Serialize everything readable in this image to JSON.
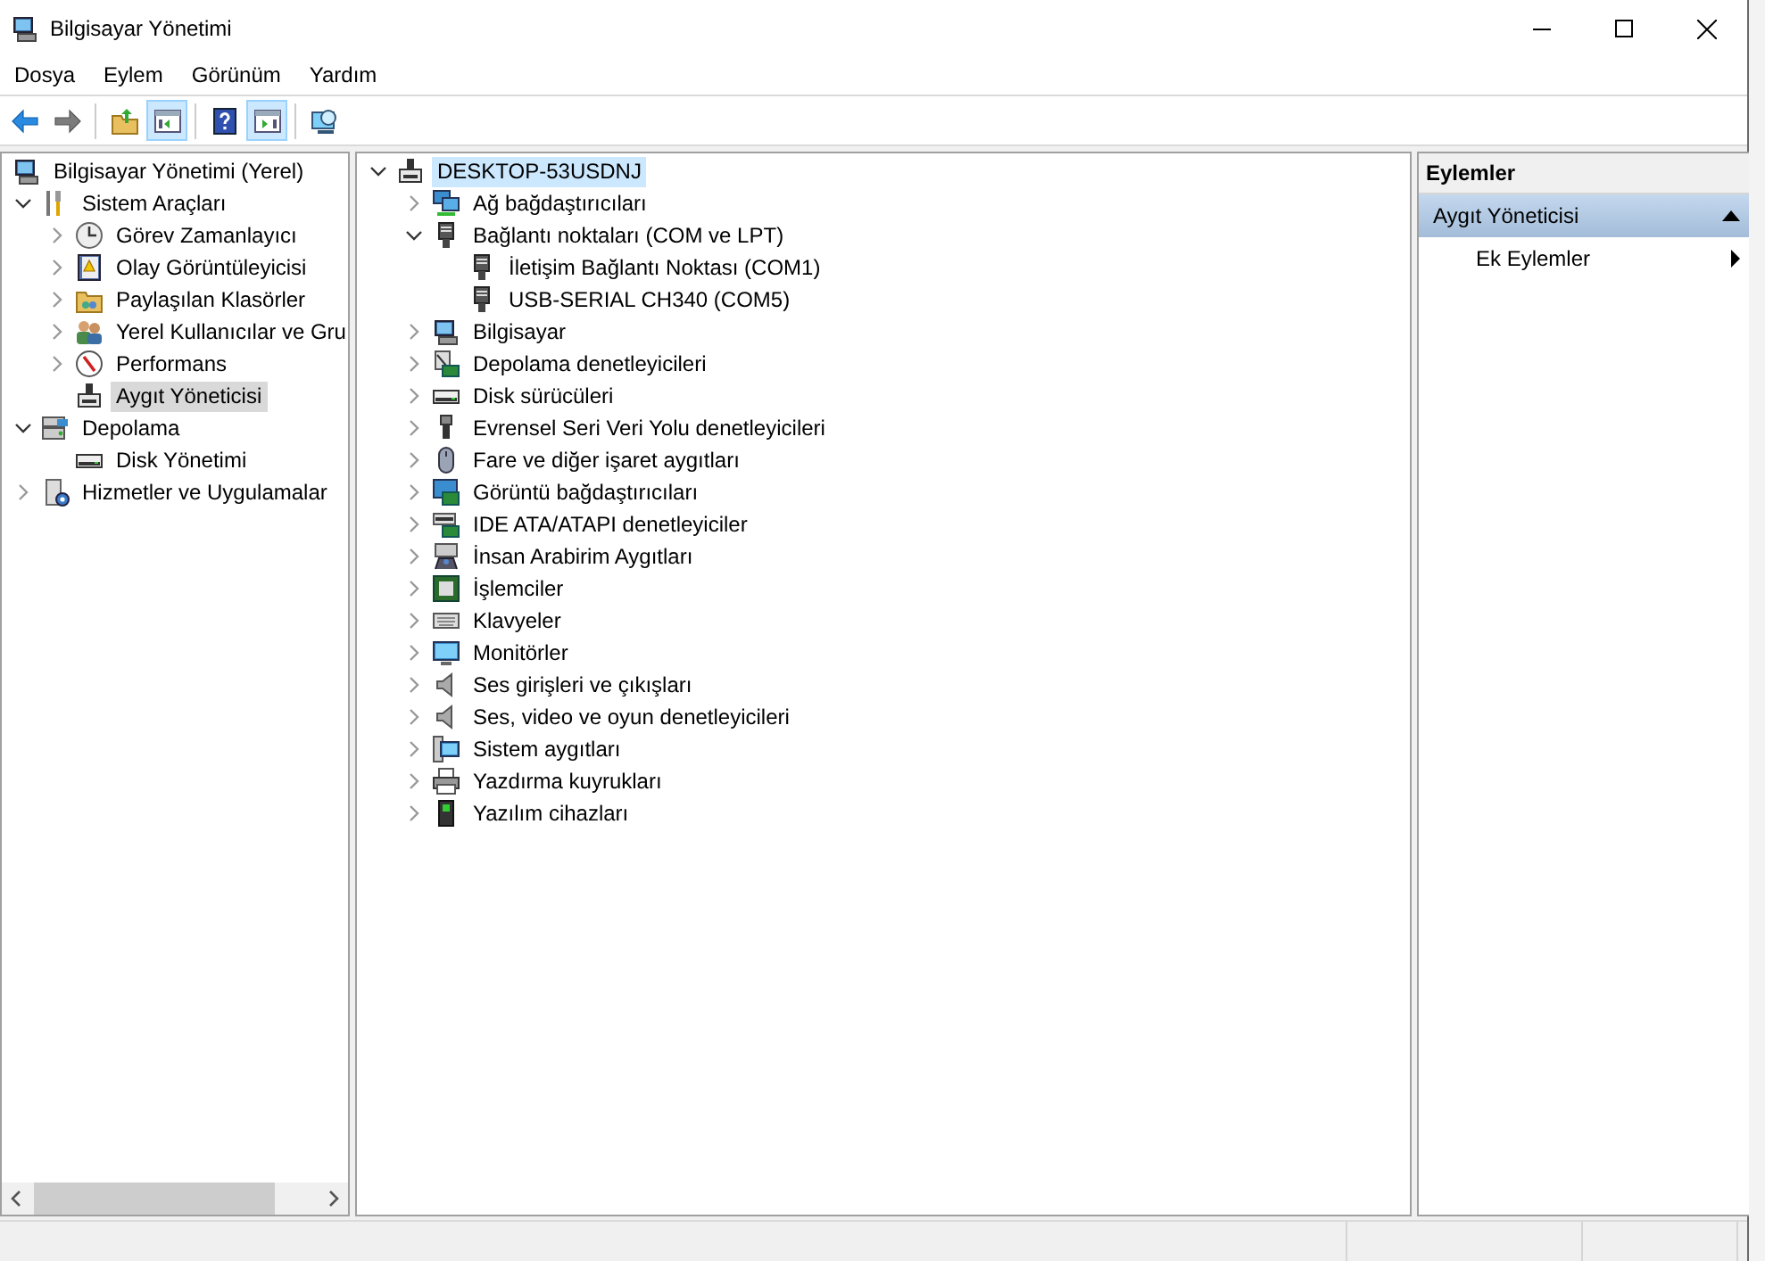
{
  "window": {
    "title": "Bilgisayar Yönetimi"
  },
  "menu": [
    "Dosya",
    "Eylem",
    "Görünüm",
    "Yardım"
  ],
  "toolbar": [
    {
      "pressed": false,
      "disabled": false
    },
    {
      "pressed": false,
      "disabled": true
    },
    {
      "pressed": false,
      "disabled": false
    },
    {
      "pressed": true,
      "disabled": false
    },
    {
      "pressed": false,
      "disabled": false
    },
    {
      "pressed": true,
      "disabled": false
    },
    {
      "pressed": false,
      "disabled": false
    }
  ],
  "nav_tree": {
    "items": [
      {
        "label": "Bilgisayar Yönetimi (Yerel)",
        "kind": "root",
        "selected": false,
        "children": [
          {
            "label": "Sistem Araçları",
            "kind": "node",
            "expanded": true,
            "selected": false,
            "children": [
              {
                "label": "Görev Zamanlayıcı",
                "kind": "node",
                "expanded": false,
                "selected": false
              },
              {
                "label": "Olay Görüntüleyicisi",
                "kind": "node",
                "expanded": false,
                "selected": false
              },
              {
                "label": "Paylaşılan Klasörler",
                "kind": "node",
                "expanded": false,
                "selected": false
              },
              {
                "label": "Yerel Kullanıcılar ve Gru",
                "kind": "node",
                "expanded": false,
                "selected": false
              },
              {
                "label": "Performans",
                "kind": "node",
                "expanded": false,
                "selected": false
              },
              {
                "label": "Aygıt Yöneticisi",
                "kind": "leaf",
                "selected": true
              }
            ]
          },
          {
            "label": "Depolama",
            "kind": "node",
            "expanded": true,
            "selected": false,
            "children": [
              {
                "label": "Disk Yönetimi",
                "kind": "leaf",
                "selected": false
              }
            ]
          },
          {
            "label": "Hizmetler ve Uygulamalar",
            "kind": "node",
            "expanded": false,
            "selected": false
          }
        ]
      }
    ]
  },
  "device_tree": {
    "items": [
      {
        "label": "DESKTOP-53USDNJ",
        "kind": "node",
        "expanded": true,
        "selected": true,
        "children": [
          {
            "label": "Ağ bağdaştırıcıları",
            "kind": "node",
            "expanded": false,
            "selected": false
          },
          {
            "label": "Bağlantı noktaları (COM ve LPT)",
            "kind": "node",
            "expanded": true,
            "selected": false,
            "children": [
              {
                "label": "İletişim Bağlantı Noktası (COM1)",
                "kind": "leaf",
                "selected": false
              },
              {
                "label": "USB-SERIAL CH340 (COM5)",
                "kind": "leaf",
                "selected": false
              }
            ]
          },
          {
            "label": "Bilgisayar",
            "kind": "node",
            "expanded": false,
            "selected": false
          },
          {
            "label": "Depolama denetleyicileri",
            "kind": "node",
            "expanded": false,
            "selected": false
          },
          {
            "label": "Disk sürücüleri",
            "kind": "node",
            "expanded": false,
            "selected": false
          },
          {
            "label": "Evrensel Seri Veri Yolu denetleyicileri",
            "kind": "node",
            "expanded": false,
            "selected": false
          },
          {
            "label": "Fare ve diğer işaret aygıtları",
            "kind": "node",
            "expanded": false,
            "selected": false
          },
          {
            "label": "Görüntü bağdaştırıcıları",
            "kind": "node",
            "expanded": false,
            "selected": false
          },
          {
            "label": "IDE ATA/ATAPI denetleyiciler",
            "kind": "node",
            "expanded": false,
            "selected": false
          },
          {
            "label": "İnsan Arabirim Aygıtları",
            "kind": "node",
            "expanded": false,
            "selected": false
          },
          {
            "label": "İşlemciler",
            "kind": "node",
            "expanded": false,
            "selected": false
          },
          {
            "label": "Klavyeler",
            "kind": "node",
            "expanded": false,
            "selected": false
          },
          {
            "label": "Monitörler",
            "kind": "node",
            "expanded": false,
            "selected": false
          },
          {
            "label": "Ses girişleri ve çıkışları",
            "kind": "node",
            "expanded": false,
            "selected": false
          },
          {
            "label": "Ses, video ve oyun denetleyicileri",
            "kind": "node",
            "expanded": false,
            "selected": false
          },
          {
            "label": "Sistem aygıtları",
            "kind": "node",
            "expanded": false,
            "selected": false
          },
          {
            "label": "Yazdırma kuyrukları",
            "kind": "node",
            "expanded": false,
            "selected": false
          },
          {
            "label": "Yazılım cihazları",
            "kind": "node",
            "expanded": false,
            "selected": false
          }
        ]
      }
    ]
  },
  "actions": {
    "title": "Eylemler",
    "sections": [
      {
        "label": "Aygıt Yöneticisi",
        "expanded": true,
        "items": [
          "Ek Eylemler"
        ]
      }
    ]
  }
}
